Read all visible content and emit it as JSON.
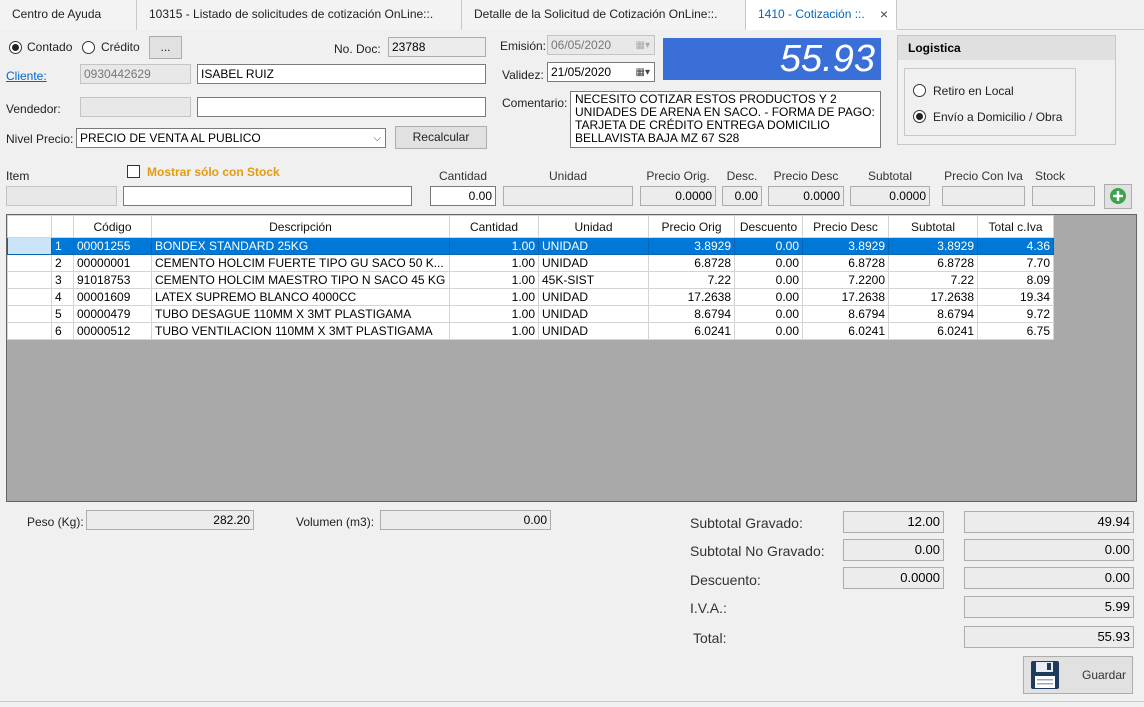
{
  "tabs": [
    {
      "label": "Centro de Ayuda"
    },
    {
      "label": "10315 - Listado de solicitudes de cotización OnLine::."
    },
    {
      "label": "Detalle de la Solicitud de Cotización OnLine::."
    },
    {
      "label": "1410 - Cotización ::."
    }
  ],
  "tab_close": "×",
  "payment": {
    "contado": "Contado",
    "credito": "Crédito",
    "ellipsis": "..."
  },
  "doc": {
    "label": "No. Doc:",
    "value": "23788"
  },
  "cliente": {
    "label": "Cliente:",
    "id": "0930442629",
    "name": "ISABEL RUIZ"
  },
  "vendedor": {
    "label": "Vendedor:",
    "id": "",
    "name": ""
  },
  "nivel_precio": {
    "label": "Nivel Precio:",
    "value": "PRECIO DE VENTA AL PUBLICO",
    "recalcular": "Recalcular"
  },
  "emision": {
    "label": "Emisión:",
    "value": "06/05/2020"
  },
  "validez": {
    "label": "Validez:",
    "value": "21/05/2020"
  },
  "comentario": {
    "label": "Comentario:",
    "value": "NECESITO COTIZAR ESTOS PRODUCTOS Y 2 UNIDADES DE ARENA EN SACO.  - FORMA DE PAGO: TARJETA DE CRÉDITO ENTREGA DOMICILIO BELLAVISTA BAJA MZ 67 S28"
  },
  "big_total": "55.93",
  "logistica": {
    "title": "Logistica",
    "retiro": "Retiro en Local",
    "envio": "Envío a Domicilio / Obra"
  },
  "entry": {
    "item": "Item",
    "mostrar_stock": "Mostrar sólo con Stock",
    "cantidad": "Cantidad",
    "unidad": "Unidad",
    "precio_orig": "Precio Orig.",
    "desc": "Desc.",
    "precio_desc": "Precio Desc",
    "subtotal": "Subtotal",
    "precio_con_iva": "Precio Con Iva",
    "stock": "Stock",
    "cantidad_val": "0.00",
    "precio_orig_val": "0.0000",
    "desc_val": "0.00",
    "precio_desc_val": "0.0000",
    "subtotal_val": "0.0000"
  },
  "grid": {
    "columns": [
      "Código",
      "Descripción",
      "Cantidad",
      "Unidad",
      "Precio Orig",
      "Descuento",
      "Precio Desc",
      "Subtotal",
      "Total c.Iva"
    ],
    "rows": [
      [
        "1",
        "00001255",
        "BONDEX STANDARD 25KG",
        "1.00",
        "UNIDAD",
        "3.8929",
        "0.00",
        "3.8929",
        "3.8929",
        "4.36"
      ],
      [
        "2",
        "00000001",
        "CEMENTO HOLCIM FUERTE TIPO GU SACO 50 K...",
        "1.00",
        "UNIDAD",
        "6.8728",
        "0.00",
        "6.8728",
        "6.8728",
        "7.70"
      ],
      [
        "3",
        "91018753",
        "CEMENTO HOLCIM MAESTRO TIPO N SACO 45 KG",
        "1.00",
        "45K-SIST",
        "7.22",
        "0.00",
        "7.2200",
        "7.22",
        "8.09"
      ],
      [
        "4",
        "00001609",
        "LATEX SUPREMO BLANCO 4000CC",
        "1.00",
        "UNIDAD",
        "17.2638",
        "0.00",
        "17.2638",
        "17.2638",
        "19.34"
      ],
      [
        "5",
        "00000479",
        "TUBO DESAGUE 110MM X 3MT PLASTIGAMA",
        "1.00",
        "UNIDAD",
        "8.6794",
        "0.00",
        "8.6794",
        "8.6794",
        "9.72"
      ],
      [
        "6",
        "00000512",
        "TUBO VENTILACION 110MM X 3MT PLASTIGAMA",
        "1.00",
        "UNIDAD",
        "6.0241",
        "0.00",
        "6.0241",
        "6.0241",
        "6.75"
      ]
    ]
  },
  "peso": {
    "label": "Peso (Kg):",
    "value": "282.20"
  },
  "volumen": {
    "label": "Volumen (m3):",
    "value": "0.00"
  },
  "totals": {
    "subtotal_gravado": {
      "label": "Subtotal Gravado:",
      "a": "12.00",
      "b": "49.94"
    },
    "subtotal_no_gravado": {
      "label": "Subtotal No Gravado:",
      "a": "0.00",
      "b": "0.00"
    },
    "descuento": {
      "label": "Descuento:",
      "a": "0.0000",
      "b": "0.00"
    },
    "iva": {
      "label": "I.V.A.:",
      "b": "5.99"
    },
    "total": {
      "label": "Total:",
      "b": "55.93"
    }
  },
  "guardar": "Guardar"
}
